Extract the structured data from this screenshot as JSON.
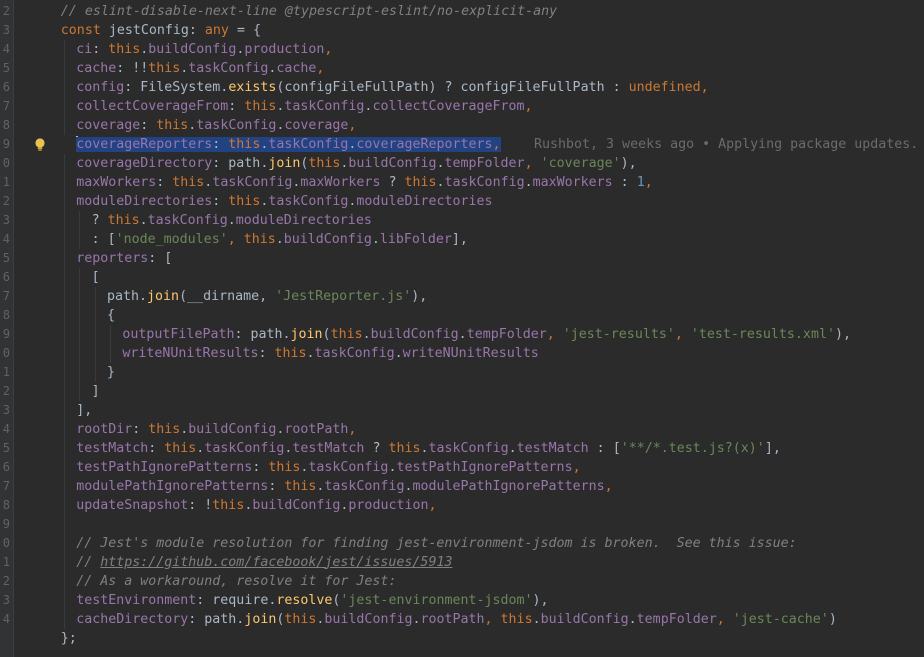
{
  "editor": {
    "theme_colors": {
      "background": "#2b2b2b",
      "keyword": "#cc7832",
      "function": "#ffc66d",
      "property": "#9876aa",
      "string": "#6a8759",
      "number": "#6897bb",
      "comment": "#808080",
      "selection": "#214283"
    },
    "gutter_numbers": [
      "2",
      "3",
      "4",
      "5",
      "6",
      "7",
      "8",
      "9",
      "0",
      "1",
      "2",
      "3",
      "4",
      "5",
      "6",
      "7",
      "8",
      "9",
      "0",
      "1",
      "2",
      "3",
      "4",
      "5",
      "6",
      "7",
      "8",
      "9",
      "0",
      "1",
      "2",
      "3",
      "4"
    ],
    "intention_icon": "lightbulb-icon",
    "blame_annotation": "Rushbot, 3 weeks ago • Applying package updates."
  },
  "lines": [
    {
      "indent": 4,
      "guides": [],
      "tokens": [
        {
          "t": "// eslint-disable-next-line @typescript-eslint/no-explicit-any",
          "c": "cm"
        }
      ]
    },
    {
      "indent": 4,
      "guides": [],
      "tokens": [
        {
          "t": "const ",
          "c": "kw"
        },
        {
          "t": "jestConfig: ",
          "c": "pn"
        },
        {
          "t": "any",
          "c": "kw"
        },
        {
          "t": " = {",
          "c": "pn"
        }
      ]
    },
    {
      "indent": 6,
      "guides": [
        4
      ],
      "tokens": [
        {
          "t": "ci",
          "c": "prop"
        },
        {
          "t": ": ",
          "c": "pn"
        },
        {
          "t": "this",
          "c": "kw"
        },
        {
          "t": ".",
          "c": "pn"
        },
        {
          "t": "buildConfig",
          "c": "prop"
        },
        {
          "t": ".",
          "c": "pn"
        },
        {
          "t": "production",
          "c": "prop"
        },
        {
          "t": ",",
          "c": "kw"
        }
      ]
    },
    {
      "indent": 6,
      "guides": [
        4
      ],
      "tokens": [
        {
          "t": "cache",
          "c": "prop"
        },
        {
          "t": ": !!",
          "c": "pn"
        },
        {
          "t": "this",
          "c": "kw"
        },
        {
          "t": ".",
          "c": "pn"
        },
        {
          "t": "taskConfig",
          "c": "prop"
        },
        {
          "t": ".",
          "c": "pn"
        },
        {
          "t": "cache",
          "c": "prop"
        },
        {
          "t": ",",
          "c": "kw"
        }
      ]
    },
    {
      "indent": 6,
      "guides": [
        4
      ],
      "tokens": [
        {
          "t": "config",
          "c": "prop"
        },
        {
          "t": ": FileSystem.",
          "c": "pn"
        },
        {
          "t": "exists",
          "c": "fn"
        },
        {
          "t": "(configFileFullPath) ? configFileFullPath : ",
          "c": "pn"
        },
        {
          "t": "undefined",
          "c": "kw"
        },
        {
          "t": ",",
          "c": "kw"
        }
      ]
    },
    {
      "indent": 6,
      "guides": [
        4
      ],
      "tokens": [
        {
          "t": "collectCoverageFrom",
          "c": "prop"
        },
        {
          "t": ": ",
          "c": "pn"
        },
        {
          "t": "this",
          "c": "kw"
        },
        {
          "t": ".",
          "c": "pn"
        },
        {
          "t": "taskConfig",
          "c": "prop"
        },
        {
          "t": ".",
          "c": "pn"
        },
        {
          "t": "collectCoverageFrom",
          "c": "prop"
        },
        {
          "t": ",",
          "c": "kw"
        }
      ]
    },
    {
      "indent": 6,
      "guides": [
        4
      ],
      "tokens": [
        {
          "t": "coverage",
          "c": "prop"
        },
        {
          "t": ": ",
          "c": "pn"
        },
        {
          "t": "this",
          "c": "kw"
        },
        {
          "t": ".",
          "c": "pn"
        },
        {
          "t": "taskConfig",
          "c": "prop"
        },
        {
          "t": ".",
          "c": "pn"
        },
        {
          "t": "coverage",
          "c": "prop"
        },
        {
          "t": ",",
          "c": "kw"
        }
      ]
    },
    {
      "indent": 6,
      "guides": [],
      "bulb": true,
      "caret": true,
      "blame": true,
      "tokens": [
        {
          "t": "coverageReporters",
          "c": "prop sel"
        },
        {
          "t": ": ",
          "c": "pn sel"
        },
        {
          "t": "this",
          "c": "kw sel"
        },
        {
          "t": ".",
          "c": "pn sel"
        },
        {
          "t": "taskConfig",
          "c": "prop sel"
        },
        {
          "t": ".",
          "c": "pn sel"
        },
        {
          "t": "coverageReporters",
          "c": "prop sel"
        },
        {
          "t": ",",
          "c": "kw sel"
        }
      ]
    },
    {
      "indent": 6,
      "guides": [
        4
      ],
      "tokens": [
        {
          "t": "coverageDirectory",
          "c": "prop"
        },
        {
          "t": ": path.",
          "c": "pn"
        },
        {
          "t": "join",
          "c": "fn"
        },
        {
          "t": "(",
          "c": "pn"
        },
        {
          "t": "this",
          "c": "kw"
        },
        {
          "t": ".",
          "c": "pn"
        },
        {
          "t": "buildConfig",
          "c": "prop"
        },
        {
          "t": ".",
          "c": "pn"
        },
        {
          "t": "tempFolder",
          "c": "prop"
        },
        {
          "t": ", ",
          "c": "kw"
        },
        {
          "t": "'coverage'",
          "c": "str"
        },
        {
          "t": "),",
          "c": "pn"
        }
      ]
    },
    {
      "indent": 6,
      "guides": [
        4
      ],
      "tokens": [
        {
          "t": "maxWorkers",
          "c": "prop"
        },
        {
          "t": ": ",
          "c": "pn"
        },
        {
          "t": "this",
          "c": "kw"
        },
        {
          "t": ".",
          "c": "pn"
        },
        {
          "t": "taskConfig",
          "c": "prop"
        },
        {
          "t": ".",
          "c": "pn"
        },
        {
          "t": "maxWorkers",
          "c": "prop"
        },
        {
          "t": " ? ",
          "c": "pn"
        },
        {
          "t": "this",
          "c": "kw"
        },
        {
          "t": ".",
          "c": "pn"
        },
        {
          "t": "taskConfig",
          "c": "prop"
        },
        {
          "t": ".",
          "c": "pn"
        },
        {
          "t": "maxWorkers",
          "c": "prop"
        },
        {
          "t": " : ",
          "c": "pn"
        },
        {
          "t": "1",
          "c": "num"
        },
        {
          "t": ",",
          "c": "kw"
        }
      ]
    },
    {
      "indent": 6,
      "guides": [
        4
      ],
      "tokens": [
        {
          "t": "moduleDirectories",
          "c": "prop"
        },
        {
          "t": ": ",
          "c": "pn"
        },
        {
          "t": "this",
          "c": "kw"
        },
        {
          "t": ".",
          "c": "pn"
        },
        {
          "t": "taskConfig",
          "c": "prop"
        },
        {
          "t": ".",
          "c": "pn"
        },
        {
          "t": "moduleDirectories",
          "c": "prop"
        }
      ]
    },
    {
      "indent": 8,
      "guides": [
        4,
        6
      ],
      "tokens": [
        {
          "t": "? ",
          "c": "pn"
        },
        {
          "t": "this",
          "c": "kw"
        },
        {
          "t": ".",
          "c": "pn"
        },
        {
          "t": "taskConfig",
          "c": "prop"
        },
        {
          "t": ".",
          "c": "pn"
        },
        {
          "t": "moduleDirectories",
          "c": "prop"
        }
      ]
    },
    {
      "indent": 8,
      "guides": [
        4,
        6
      ],
      "tokens": [
        {
          "t": ": [",
          "c": "pn"
        },
        {
          "t": "'node_modules'",
          "c": "str"
        },
        {
          "t": ", ",
          "c": "kw"
        },
        {
          "t": "this",
          "c": "kw"
        },
        {
          "t": ".",
          "c": "pn"
        },
        {
          "t": "buildConfig",
          "c": "prop"
        },
        {
          "t": ".",
          "c": "pn"
        },
        {
          "t": "libFolder",
          "c": "prop"
        },
        {
          "t": "],",
          "c": "pn"
        }
      ]
    },
    {
      "indent": 6,
      "guides": [
        4
      ],
      "tokens": [
        {
          "t": "reporters",
          "c": "prop"
        },
        {
          "t": ": [",
          "c": "pn"
        }
      ]
    },
    {
      "indent": 8,
      "guides": [
        4,
        6
      ],
      "tokens": [
        {
          "t": "[",
          "c": "pn"
        }
      ]
    },
    {
      "indent": 10,
      "guides": [
        4,
        6,
        8
      ],
      "tokens": [
        {
          "t": "path.",
          "c": "pn"
        },
        {
          "t": "join",
          "c": "fn"
        },
        {
          "t": "(__dirname, ",
          "c": "pn"
        },
        {
          "t": "'JestReporter.js'",
          "c": "str"
        },
        {
          "t": "),",
          "c": "pn"
        }
      ]
    },
    {
      "indent": 10,
      "guides": [
        4,
        6,
        8
      ],
      "tokens": [
        {
          "t": "{",
          "c": "pn"
        }
      ]
    },
    {
      "indent": 12,
      "guides": [
        4,
        6,
        8,
        10
      ],
      "tokens": [
        {
          "t": "outputFilePath",
          "c": "prop"
        },
        {
          "t": ": path.",
          "c": "pn"
        },
        {
          "t": "join",
          "c": "fn"
        },
        {
          "t": "(",
          "c": "pn"
        },
        {
          "t": "this",
          "c": "kw"
        },
        {
          "t": ".",
          "c": "pn"
        },
        {
          "t": "buildConfig",
          "c": "prop"
        },
        {
          "t": ".",
          "c": "pn"
        },
        {
          "t": "tempFolder",
          "c": "prop"
        },
        {
          "t": ", ",
          "c": "kw"
        },
        {
          "t": "'jest-results'",
          "c": "str"
        },
        {
          "t": ", ",
          "c": "kw"
        },
        {
          "t": "'test-results.xml'",
          "c": "str"
        },
        {
          "t": "),",
          "c": "pn"
        }
      ]
    },
    {
      "indent": 12,
      "guides": [
        4,
        6,
        8,
        10
      ],
      "tokens": [
        {
          "t": "writeNUnitResults",
          "c": "prop"
        },
        {
          "t": ": ",
          "c": "pn"
        },
        {
          "t": "this",
          "c": "kw"
        },
        {
          "t": ".",
          "c": "pn"
        },
        {
          "t": "taskConfig",
          "c": "prop"
        },
        {
          "t": ".",
          "c": "pn"
        },
        {
          "t": "writeNUnitResults",
          "c": "prop"
        }
      ]
    },
    {
      "indent": 10,
      "guides": [
        4,
        6,
        8
      ],
      "tokens": [
        {
          "t": "}",
          "c": "pn"
        }
      ]
    },
    {
      "indent": 8,
      "guides": [
        4,
        6
      ],
      "tokens": [
        {
          "t": "]",
          "c": "pn"
        }
      ]
    },
    {
      "indent": 6,
      "guides": [
        4
      ],
      "tokens": [
        {
          "t": "],",
          "c": "pn"
        }
      ]
    },
    {
      "indent": 6,
      "guides": [
        4
      ],
      "tokens": [
        {
          "t": "rootDir",
          "c": "prop"
        },
        {
          "t": ": ",
          "c": "pn"
        },
        {
          "t": "this",
          "c": "kw"
        },
        {
          "t": ".",
          "c": "pn"
        },
        {
          "t": "buildConfig",
          "c": "prop"
        },
        {
          "t": ".",
          "c": "pn"
        },
        {
          "t": "rootPath",
          "c": "prop"
        },
        {
          "t": ",",
          "c": "kw"
        }
      ]
    },
    {
      "indent": 6,
      "guides": [
        4
      ],
      "tokens": [
        {
          "t": "testMatch",
          "c": "prop"
        },
        {
          "t": ": ",
          "c": "pn"
        },
        {
          "t": "this",
          "c": "kw"
        },
        {
          "t": ".",
          "c": "pn"
        },
        {
          "t": "taskConfig",
          "c": "prop"
        },
        {
          "t": ".",
          "c": "pn"
        },
        {
          "t": "testMatch",
          "c": "prop"
        },
        {
          "t": " ? ",
          "c": "pn"
        },
        {
          "t": "this",
          "c": "kw"
        },
        {
          "t": ".",
          "c": "pn"
        },
        {
          "t": "taskConfig",
          "c": "prop"
        },
        {
          "t": ".",
          "c": "pn"
        },
        {
          "t": "testMatch",
          "c": "prop"
        },
        {
          "t": " : [",
          "c": "pn"
        },
        {
          "t": "'**/*.test.js?(x)'",
          "c": "str"
        },
        {
          "t": "],",
          "c": "pn"
        }
      ]
    },
    {
      "indent": 6,
      "guides": [
        4
      ],
      "tokens": [
        {
          "t": "testPathIgnorePatterns",
          "c": "prop"
        },
        {
          "t": ": ",
          "c": "pn"
        },
        {
          "t": "this",
          "c": "kw"
        },
        {
          "t": ".",
          "c": "pn"
        },
        {
          "t": "taskConfig",
          "c": "prop"
        },
        {
          "t": ".",
          "c": "pn"
        },
        {
          "t": "testPathIgnorePatterns",
          "c": "prop"
        },
        {
          "t": ",",
          "c": "kw"
        }
      ]
    },
    {
      "indent": 6,
      "guides": [
        4
      ],
      "tokens": [
        {
          "t": "modulePathIgnorePatterns",
          "c": "prop"
        },
        {
          "t": ": ",
          "c": "pn"
        },
        {
          "t": "this",
          "c": "kw"
        },
        {
          "t": ".",
          "c": "pn"
        },
        {
          "t": "taskConfig",
          "c": "prop"
        },
        {
          "t": ".",
          "c": "pn"
        },
        {
          "t": "modulePathIgnorePatterns",
          "c": "prop"
        },
        {
          "t": ",",
          "c": "kw"
        }
      ]
    },
    {
      "indent": 6,
      "guides": [
        4
      ],
      "tokens": [
        {
          "t": "updateSnapshot",
          "c": "prop"
        },
        {
          "t": ": !",
          "c": "pn"
        },
        {
          "t": "this",
          "c": "kw"
        },
        {
          "t": ".",
          "c": "pn"
        },
        {
          "t": "buildConfig",
          "c": "prop"
        },
        {
          "t": ".",
          "c": "pn"
        },
        {
          "t": "production",
          "c": "prop"
        },
        {
          "t": ",",
          "c": "kw"
        }
      ]
    },
    {
      "indent": 0,
      "guides": [
        4
      ],
      "tokens": []
    },
    {
      "indent": 6,
      "guides": [
        4
      ],
      "tokens": [
        {
          "t": "// Jest's module resolution for finding jest-environment-jsdom is broken.  See this issue:",
          "c": "cm"
        }
      ]
    },
    {
      "indent": 6,
      "guides": [
        4
      ],
      "tokens": [
        {
          "t": "// ",
          "c": "cm"
        },
        {
          "t": "https://github.com/facebook/jest/issues/5913",
          "c": "lnk"
        }
      ]
    },
    {
      "indent": 6,
      "guides": [
        4
      ],
      "tokens": [
        {
          "t": "// As a workaround, resolve it for Jest:",
          "c": "cm"
        }
      ]
    },
    {
      "indent": 6,
      "guides": [
        4
      ],
      "tokens": [
        {
          "t": "testEnvironment",
          "c": "prop"
        },
        {
          "t": ": require.",
          "c": "pn"
        },
        {
          "t": "resolve",
          "c": "fn"
        },
        {
          "t": "(",
          "c": "pn"
        },
        {
          "t": "'jest-environment-jsdom'",
          "c": "str"
        },
        {
          "t": "),",
          "c": "pn"
        }
      ]
    },
    {
      "indent": 6,
      "guides": [
        4
      ],
      "tokens": [
        {
          "t": "cacheDirectory",
          "c": "prop"
        },
        {
          "t": ": path.",
          "c": "pn"
        },
        {
          "t": "join",
          "c": "fn"
        },
        {
          "t": "(",
          "c": "pn"
        },
        {
          "t": "this",
          "c": "kw"
        },
        {
          "t": ".",
          "c": "pn"
        },
        {
          "t": "buildConfig",
          "c": "prop"
        },
        {
          "t": ".",
          "c": "pn"
        },
        {
          "t": "rootPath",
          "c": "prop"
        },
        {
          "t": ", ",
          "c": "kw"
        },
        {
          "t": "this",
          "c": "kw"
        },
        {
          "t": ".",
          "c": "pn"
        },
        {
          "t": "buildConfig",
          "c": "prop"
        },
        {
          "t": ".",
          "c": "pn"
        },
        {
          "t": "tempFolder",
          "c": "prop"
        },
        {
          "t": ", ",
          "c": "kw"
        },
        {
          "t": "'jest-cache'",
          "c": "str"
        },
        {
          "t": ")",
          "c": "pn"
        }
      ]
    },
    {
      "indent": 4,
      "guides": [],
      "tokens": [
        {
          "t": "};",
          "c": "pn"
        }
      ]
    }
  ]
}
